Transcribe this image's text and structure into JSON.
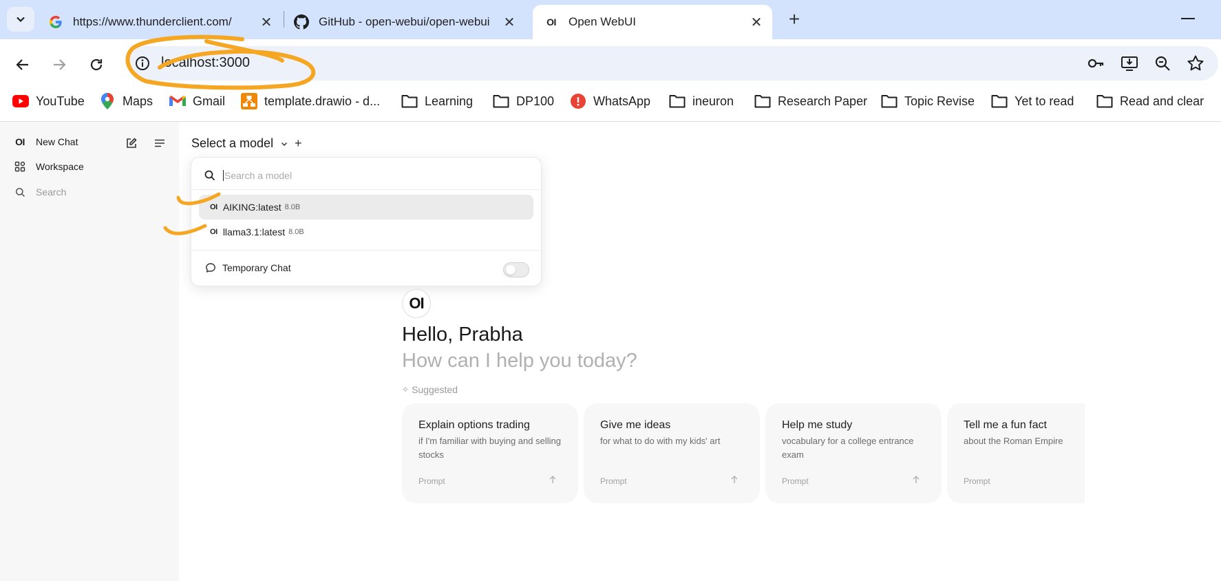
{
  "browser": {
    "tabs": [
      {
        "title": "https://www.thunderclient.com/",
        "favicon": "google-icon"
      },
      {
        "title": "GitHub - open-webui/open-webui",
        "favicon": "github-icon"
      },
      {
        "title": "Open WebUI",
        "favicon": "openwebui-icon",
        "active": true
      }
    ],
    "url": "localhost:3000",
    "bookmarks": [
      {
        "label": "YouTube",
        "icon": "youtube-icon"
      },
      {
        "label": "Maps",
        "icon": "maps-icon"
      },
      {
        "label": "Gmail",
        "icon": "gmail-icon"
      },
      {
        "label": "template.drawio - d...",
        "icon": "drawio-icon"
      },
      {
        "label": "Learning",
        "icon": "folder-icon"
      },
      {
        "label": "DP100",
        "icon": "folder-icon"
      },
      {
        "label": "WhatsApp",
        "icon": "whatsapp-icon"
      },
      {
        "label": "ineuron",
        "icon": "folder-icon"
      },
      {
        "label": "Research Paper",
        "icon": "folder-icon"
      },
      {
        "label": "Topic Revise",
        "icon": "folder-icon"
      },
      {
        "label": "Yet to read",
        "icon": "folder-icon"
      },
      {
        "label": "Read and clear",
        "icon": "folder-icon"
      }
    ]
  },
  "sidebar": {
    "logo": "OI",
    "new_chat": "New Chat",
    "workspace": "Workspace",
    "search": "Search"
  },
  "main": {
    "model_select": "Select a model",
    "plus": "+",
    "dropdown": {
      "search_placeholder": "Search a model",
      "models": [
        {
          "logo": "OI",
          "name": "AIKING:latest",
          "size": "8.0B",
          "selected": true
        },
        {
          "logo": "OI",
          "name": "llama3.1:latest",
          "size": "8.0B",
          "selected": false
        }
      ],
      "temporary_chat": "Temporary Chat",
      "temporary_chat_enabled": false
    },
    "logo": "OI",
    "greeting": "Hello, Prabha",
    "subgreeting": "How can I help you today?",
    "suggested_label": "Suggested",
    "suggestions": [
      {
        "title": "Explain options trading",
        "subtitle": "if I'm familiar with buying and selling stocks",
        "prompt": "Prompt"
      },
      {
        "title": "Give me ideas",
        "subtitle": "for what to do with my kids' art",
        "prompt": "Prompt"
      },
      {
        "title": "Help me study",
        "subtitle": "vocabulary for a college entrance exam",
        "prompt": "Prompt"
      },
      {
        "title": "Tell me a fun fact",
        "subtitle": "about the Roman Empire",
        "prompt": "Prompt"
      }
    ]
  },
  "colors": {
    "tabstrip": "#d3e3fd",
    "omnibox": "#edf2fa",
    "annotation": "#f5a623",
    "sidebar": "#f7f7f7"
  }
}
